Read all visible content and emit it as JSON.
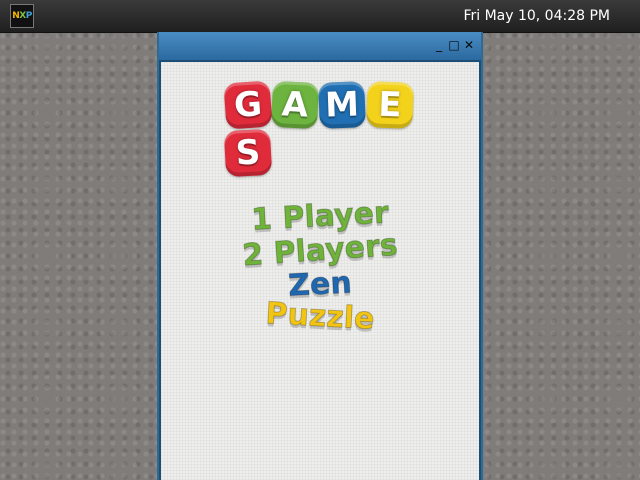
{
  "topbar": {
    "logo_text": "NXP",
    "clock": "Fri May 10, 04:28 PM"
  },
  "window": {
    "controls": {
      "minimize": "_",
      "maximize": "□",
      "close": "✕"
    }
  },
  "game": {
    "title_letters": [
      "G",
      "A",
      "M",
      "E",
      "S"
    ],
    "tile_colors": [
      "#e02b3b",
      "#6cb33f",
      "#1f6fb2",
      "#f3d21b",
      "#e02b3b"
    ],
    "menu": [
      {
        "label": "1 Player",
        "color": "#6fb33a"
      },
      {
        "label": "2 Players",
        "color": "#6fb33a"
      },
      {
        "label": "Zen",
        "color": "#1f68b0"
      },
      {
        "label": "Puzzle",
        "color": "#f2c514"
      }
    ]
  }
}
